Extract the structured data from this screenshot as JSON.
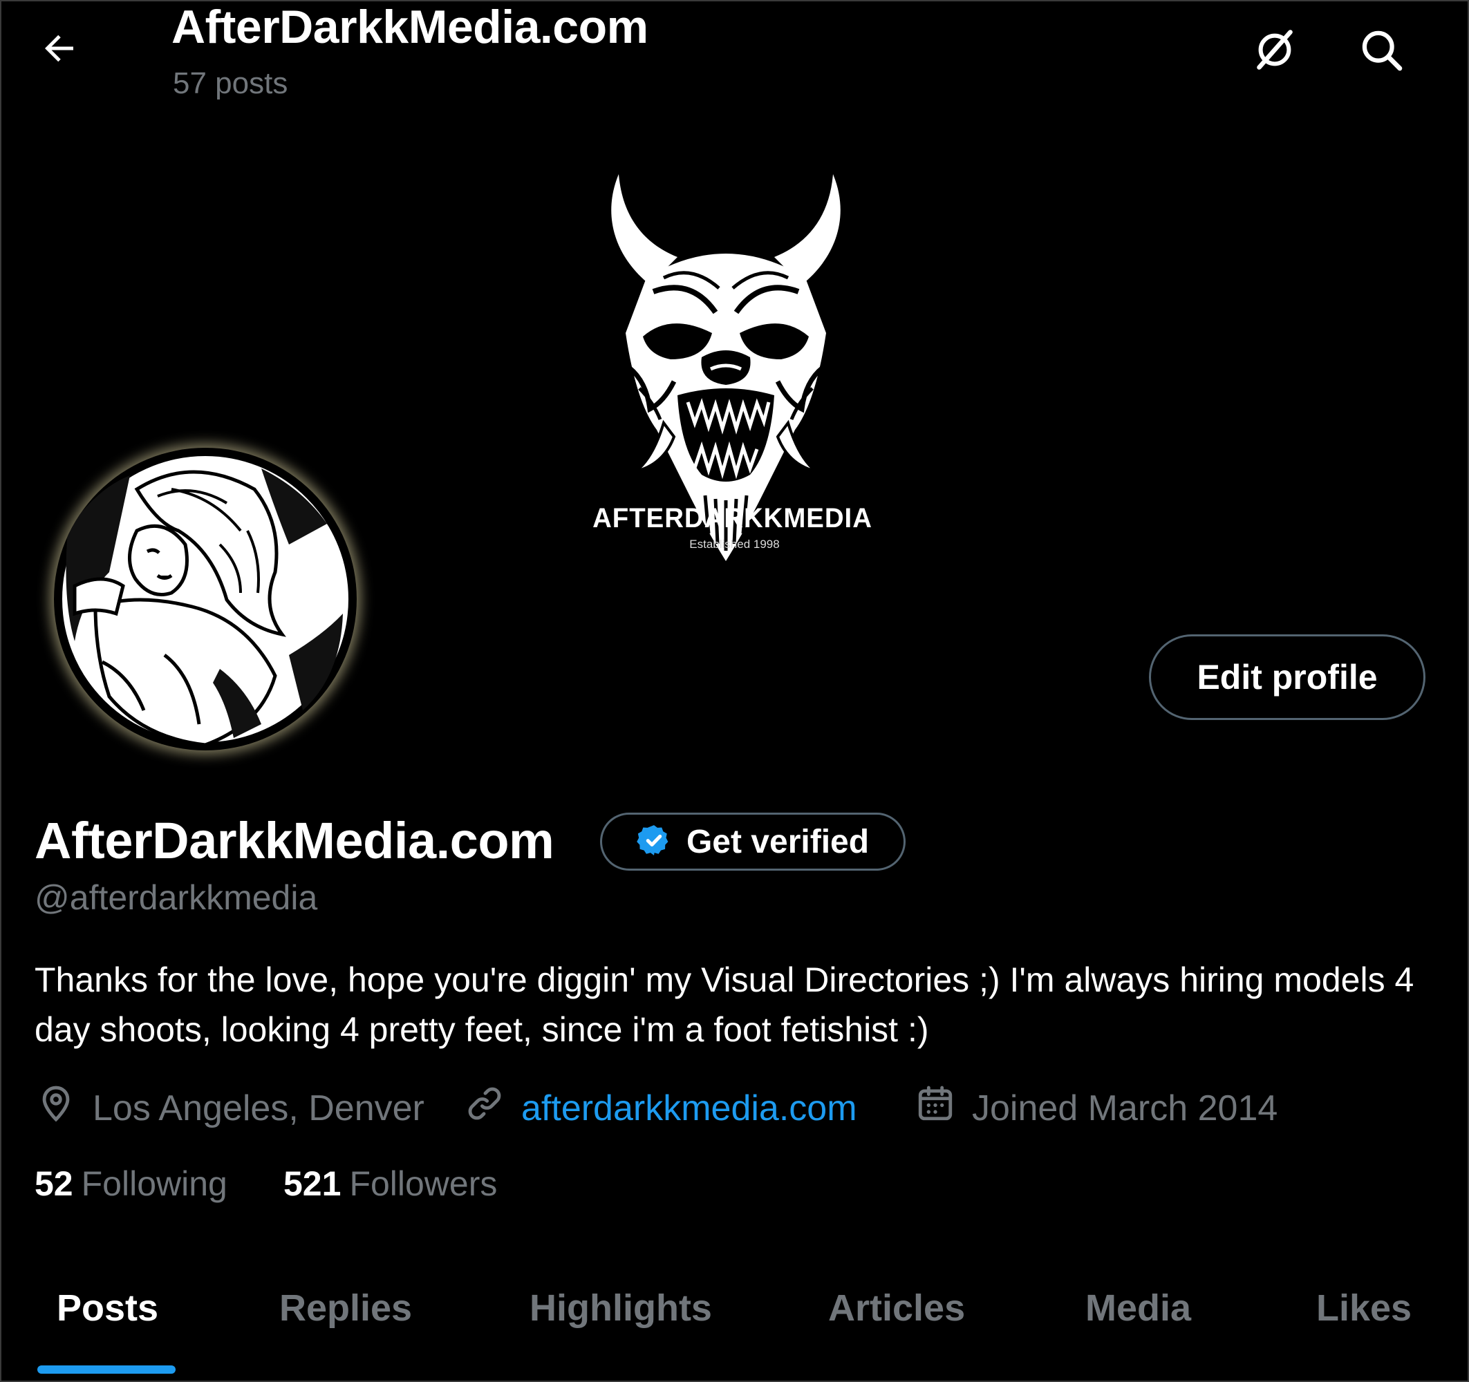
{
  "header": {
    "title": "AfterDarkkMedia.com",
    "post_count": "57 posts"
  },
  "icons": {
    "back": "arrow-left-icon",
    "premium": "grok-slash-circle-icon",
    "search": "search-icon",
    "verified": "verified-badge-icon",
    "location": "location-pin-icon",
    "link": "link-icon",
    "calendar": "calendar-icon"
  },
  "banner": {
    "logo_name": "AFTERDARKKMEDIA",
    "logo_sub": "Established 1998"
  },
  "profile": {
    "display_name": "AfterDarkkMedia.com",
    "handle": "@afterdarkkmedia",
    "edit_button": "Edit profile",
    "verify_button": "Get verified",
    "bio": "Thanks for the love, hope you're diggin' my Visual Directories ;) I'm always hiring models 4 day shoots, looking 4 pretty feet, since i'm a foot fetishist :)",
    "location": "Los Angeles, Denver",
    "website": "afterdarkkmedia.com",
    "joined": "Joined March 2014"
  },
  "stats": {
    "following_count": "52",
    "following_label": "Following",
    "followers_count": "521",
    "followers_label": "Followers"
  },
  "tabs": [
    {
      "label": "Posts",
      "active": true
    },
    {
      "label": "Replies",
      "active": false
    },
    {
      "label": "Highlights",
      "active": false
    },
    {
      "label": "Articles",
      "active": false
    },
    {
      "label": "Media",
      "active": false
    },
    {
      "label": "Likes",
      "active": false
    }
  ],
  "colors": {
    "background": "#000000",
    "accent": "#1d9bf0",
    "muted": "#71767b",
    "border": "#536471"
  }
}
